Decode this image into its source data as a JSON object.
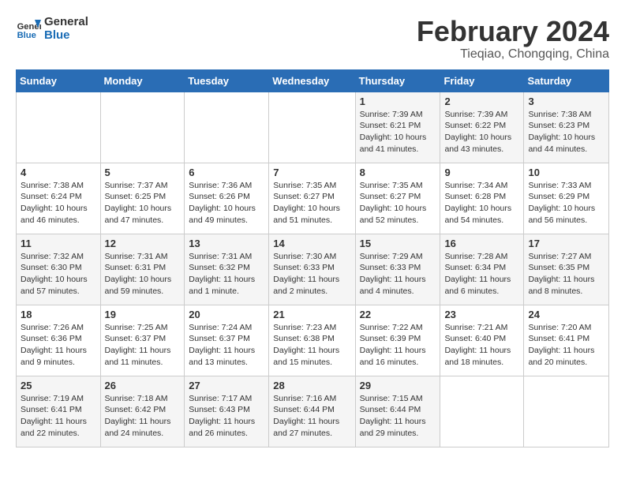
{
  "logo": {
    "line1": "General",
    "line2": "Blue"
  },
  "title": "February 2024",
  "subtitle": "Tieqiao, Chongqing, China",
  "days_of_week": [
    "Sunday",
    "Monday",
    "Tuesday",
    "Wednesday",
    "Thursday",
    "Friday",
    "Saturday"
  ],
  "weeks": [
    [
      {
        "day": "",
        "info": ""
      },
      {
        "day": "",
        "info": ""
      },
      {
        "day": "",
        "info": ""
      },
      {
        "day": "",
        "info": ""
      },
      {
        "day": "1",
        "info": "Sunrise: 7:39 AM\nSunset: 6:21 PM\nDaylight: 10 hours\nand 41 minutes."
      },
      {
        "day": "2",
        "info": "Sunrise: 7:39 AM\nSunset: 6:22 PM\nDaylight: 10 hours\nand 43 minutes."
      },
      {
        "day": "3",
        "info": "Sunrise: 7:38 AM\nSunset: 6:23 PM\nDaylight: 10 hours\nand 44 minutes."
      }
    ],
    [
      {
        "day": "4",
        "info": "Sunrise: 7:38 AM\nSunset: 6:24 PM\nDaylight: 10 hours\nand 46 minutes."
      },
      {
        "day": "5",
        "info": "Sunrise: 7:37 AM\nSunset: 6:25 PM\nDaylight: 10 hours\nand 47 minutes."
      },
      {
        "day": "6",
        "info": "Sunrise: 7:36 AM\nSunset: 6:26 PM\nDaylight: 10 hours\nand 49 minutes."
      },
      {
        "day": "7",
        "info": "Sunrise: 7:35 AM\nSunset: 6:27 PM\nDaylight: 10 hours\nand 51 minutes."
      },
      {
        "day": "8",
        "info": "Sunrise: 7:35 AM\nSunset: 6:27 PM\nDaylight: 10 hours\nand 52 minutes."
      },
      {
        "day": "9",
        "info": "Sunrise: 7:34 AM\nSunset: 6:28 PM\nDaylight: 10 hours\nand 54 minutes."
      },
      {
        "day": "10",
        "info": "Sunrise: 7:33 AM\nSunset: 6:29 PM\nDaylight: 10 hours\nand 56 minutes."
      }
    ],
    [
      {
        "day": "11",
        "info": "Sunrise: 7:32 AM\nSunset: 6:30 PM\nDaylight: 10 hours\nand 57 minutes."
      },
      {
        "day": "12",
        "info": "Sunrise: 7:31 AM\nSunset: 6:31 PM\nDaylight: 10 hours\nand 59 minutes."
      },
      {
        "day": "13",
        "info": "Sunrise: 7:31 AM\nSunset: 6:32 PM\nDaylight: 11 hours\nand 1 minute."
      },
      {
        "day": "14",
        "info": "Sunrise: 7:30 AM\nSunset: 6:33 PM\nDaylight: 11 hours\nand 2 minutes."
      },
      {
        "day": "15",
        "info": "Sunrise: 7:29 AM\nSunset: 6:33 PM\nDaylight: 11 hours\nand 4 minutes."
      },
      {
        "day": "16",
        "info": "Sunrise: 7:28 AM\nSunset: 6:34 PM\nDaylight: 11 hours\nand 6 minutes."
      },
      {
        "day": "17",
        "info": "Sunrise: 7:27 AM\nSunset: 6:35 PM\nDaylight: 11 hours\nand 8 minutes."
      }
    ],
    [
      {
        "day": "18",
        "info": "Sunrise: 7:26 AM\nSunset: 6:36 PM\nDaylight: 11 hours\nand 9 minutes."
      },
      {
        "day": "19",
        "info": "Sunrise: 7:25 AM\nSunset: 6:37 PM\nDaylight: 11 hours\nand 11 minutes."
      },
      {
        "day": "20",
        "info": "Sunrise: 7:24 AM\nSunset: 6:37 PM\nDaylight: 11 hours\nand 13 minutes."
      },
      {
        "day": "21",
        "info": "Sunrise: 7:23 AM\nSunset: 6:38 PM\nDaylight: 11 hours\nand 15 minutes."
      },
      {
        "day": "22",
        "info": "Sunrise: 7:22 AM\nSunset: 6:39 PM\nDaylight: 11 hours\nand 16 minutes."
      },
      {
        "day": "23",
        "info": "Sunrise: 7:21 AM\nSunset: 6:40 PM\nDaylight: 11 hours\nand 18 minutes."
      },
      {
        "day": "24",
        "info": "Sunrise: 7:20 AM\nSunset: 6:41 PM\nDaylight: 11 hours\nand 20 minutes."
      }
    ],
    [
      {
        "day": "25",
        "info": "Sunrise: 7:19 AM\nSunset: 6:41 PM\nDaylight: 11 hours\nand 22 minutes."
      },
      {
        "day": "26",
        "info": "Sunrise: 7:18 AM\nSunset: 6:42 PM\nDaylight: 11 hours\nand 24 minutes."
      },
      {
        "day": "27",
        "info": "Sunrise: 7:17 AM\nSunset: 6:43 PM\nDaylight: 11 hours\nand 26 minutes."
      },
      {
        "day": "28",
        "info": "Sunrise: 7:16 AM\nSunset: 6:44 PM\nDaylight: 11 hours\nand 27 minutes."
      },
      {
        "day": "29",
        "info": "Sunrise: 7:15 AM\nSunset: 6:44 PM\nDaylight: 11 hours\nand 29 minutes."
      },
      {
        "day": "",
        "info": ""
      },
      {
        "day": "",
        "info": ""
      }
    ]
  ]
}
